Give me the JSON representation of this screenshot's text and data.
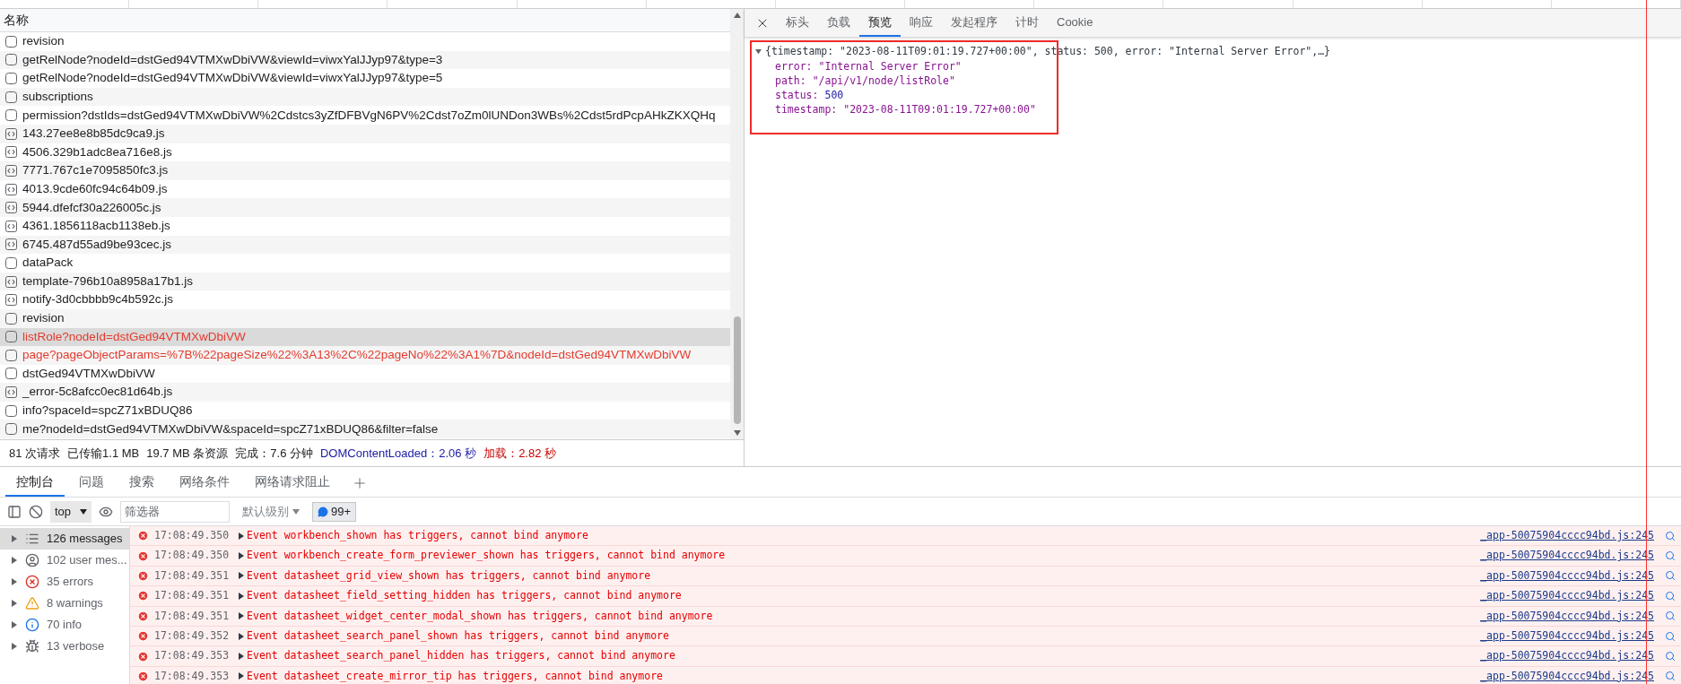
{
  "network": {
    "column_header": "名称",
    "requests": [
      {
        "name": "revision",
        "kind": "xhr",
        "error": false,
        "selected": false
      },
      {
        "name": "getRelNode?nodeId=dstGed94VTMXwDbiVW&viewId=viwxYalJJyp97&type=3",
        "kind": "xhr",
        "error": false,
        "selected": false
      },
      {
        "name": "getRelNode?nodeId=dstGed94VTMXwDbiVW&viewId=viwxYalJJyp97&type=5",
        "kind": "xhr",
        "error": false,
        "selected": false
      },
      {
        "name": "subscriptions",
        "kind": "xhr",
        "error": false,
        "selected": false
      },
      {
        "name": "permission?dstIds=dstGed94VTMXwDbiVW%2Cdstcs3yZfDFBVgN6PV%2Cdst7oZm0lUNDon3WBs%2Cdst5rdPcpAHkZKXQHq",
        "kind": "xhr",
        "error": false,
        "selected": false
      },
      {
        "name": "143.27ee8e8b85dc9ca9.js",
        "kind": "script",
        "error": false,
        "selected": false
      },
      {
        "name": "4506.329b1adc8ea716e8.js",
        "kind": "script",
        "error": false,
        "selected": false
      },
      {
        "name": "7771.767c1e7095850fc3.js",
        "kind": "script",
        "error": false,
        "selected": false
      },
      {
        "name": "4013.9cde60fc94c64b09.js",
        "kind": "script",
        "error": false,
        "selected": false
      },
      {
        "name": "5944.dfefcf30a226005c.js",
        "kind": "script",
        "error": false,
        "selected": false
      },
      {
        "name": "4361.1856118acb1138eb.js",
        "kind": "script",
        "error": false,
        "selected": false
      },
      {
        "name": "6745.487d55ad9be93cec.js",
        "kind": "script",
        "error": false,
        "selected": false
      },
      {
        "name": "dataPack",
        "kind": "xhr",
        "error": false,
        "selected": false
      },
      {
        "name": "template-796b10a8958a17b1.js",
        "kind": "script",
        "error": false,
        "selected": false
      },
      {
        "name": "notify-3d0cbbbb9c4b592c.js",
        "kind": "script",
        "error": false,
        "selected": false
      },
      {
        "name": "revision",
        "kind": "xhr",
        "error": false,
        "selected": false
      },
      {
        "name": "listRole?nodeId=dstGed94VTMXwDbiVW",
        "kind": "xhr",
        "error": true,
        "selected": true
      },
      {
        "name": "page?pageObjectParams=%7B%22pageSize%22%3A13%2C%22pageNo%22%3A1%7D&nodeId=dstGed94VTMXwDbiVW",
        "kind": "xhr",
        "error": true,
        "selected": false
      },
      {
        "name": "dstGed94VTMXwDbiVW",
        "kind": "xhr",
        "error": false,
        "selected": false
      },
      {
        "name": "_error-5c8afcc0ec81d64b.js",
        "kind": "script",
        "error": false,
        "selected": false
      },
      {
        "name": "info?spaceId=spcZ71xBDUQ86",
        "kind": "xhr",
        "error": false,
        "selected": false
      },
      {
        "name": "me?nodeId=dstGed94VTMXwDbiVW&spaceId=spcZ71xBDUQ86&filter=false",
        "kind": "xhr",
        "error": false,
        "selected": false
      }
    ],
    "summary": [
      {
        "text": "81 次请求",
        "kind": "plain"
      },
      {
        "text": "已传输1.1 MB",
        "kind": "plain"
      },
      {
        "text": "19.7 MB 条资源",
        "kind": "plain"
      },
      {
        "text": "完成：7.6 分钟",
        "kind": "plain"
      },
      {
        "text": "DOMContentLoaded：2.06 秒",
        "kind": "dom"
      },
      {
        "text": "加载：2.82 秒",
        "kind": "load"
      }
    ]
  },
  "details": {
    "tabs": [
      {
        "label": "标头",
        "selected": false
      },
      {
        "label": "负载",
        "selected": false
      },
      {
        "label": "预览",
        "selected": true
      },
      {
        "label": "响应",
        "selected": false
      },
      {
        "label": "发起程序",
        "selected": false
      },
      {
        "label": "计时",
        "selected": false
      },
      {
        "label": "Cookie",
        "selected": false
      }
    ],
    "preview": {
      "summary": "{timestamp: \"2023-08-11T09:01:19.727+00:00\", status: 500, error: \"Internal Server Error\",…}",
      "expanded": true,
      "properties": [
        {
          "key": "error:",
          "value": "\"Internal Server Error\"",
          "kind": "string"
        },
        {
          "key": "path:",
          "value": "\"/api/v1/node/listRole\"",
          "kind": "string"
        },
        {
          "key": "status:",
          "value": "500",
          "kind": "number"
        },
        {
          "key": "timestamp:",
          "value": "\"2023-08-11T09:01:19.727+00:00\"",
          "kind": "string"
        }
      ]
    }
  },
  "console": {
    "tabs": [
      {
        "label": "控制台",
        "selected": true
      },
      {
        "label": "问题",
        "selected": false
      },
      {
        "label": "搜索",
        "selected": false
      },
      {
        "label": "网络条件",
        "selected": false
      },
      {
        "label": "网络请求阻止",
        "selected": false
      }
    ],
    "context": "top",
    "filter_placeholder": "筛选器",
    "level": "默认级别",
    "issues_badge": "99+",
    "sidebar": [
      {
        "label": "126 messages",
        "kind": "all",
        "selected": true
      },
      {
        "label": "102 user mes...",
        "kind": "user",
        "selected": false
      },
      {
        "label": "35 errors",
        "kind": "error",
        "selected": false
      },
      {
        "label": "8 warnings",
        "kind": "warning",
        "selected": false
      },
      {
        "label": "70 info",
        "kind": "info",
        "selected": false
      },
      {
        "label": "13 verbose",
        "kind": "verbose",
        "selected": false
      }
    ],
    "messages": [
      {
        "time": "17:08:49.350",
        "text": "Event workbench_shown has triggers, cannot bind anymore",
        "source": "_app-50075904cccc94bd.js:245"
      },
      {
        "time": "17:08:49.350",
        "text": "Event workbench_create_form_previewer_shown has triggers, cannot bind anymore",
        "source": "_app-50075904cccc94bd.js:245"
      },
      {
        "time": "17:08:49.351",
        "text": "Event datasheet_grid_view_shown has triggers, cannot bind anymore",
        "source": "_app-50075904cccc94bd.js:245"
      },
      {
        "time": "17:08:49.351",
        "text": "Event datasheet_field_setting_hidden has triggers, cannot bind anymore",
        "source": "_app-50075904cccc94bd.js:245"
      },
      {
        "time": "17:08:49.351",
        "text": "Event datasheet_widget_center_modal_shown has triggers, cannot bind anymore",
        "source": "_app-50075904cccc94bd.js:245"
      },
      {
        "time": "17:08:49.352",
        "text": "Event datasheet_search_panel_shown has triggers, cannot bind anymore",
        "source": "_app-50075904cccc94bd.js:245"
      },
      {
        "time": "17:08:49.353",
        "text": "Event datasheet_search_panel_hidden has triggers, cannot bind anymore",
        "source": "_app-50075904cccc94bd.js:245"
      },
      {
        "time": "17:08:49.353",
        "text": "Event datasheet_create_mirror_tip has triggers, cannot bind anymore",
        "source": "_app-50075904cccc94bd.js:245"
      }
    ]
  }
}
